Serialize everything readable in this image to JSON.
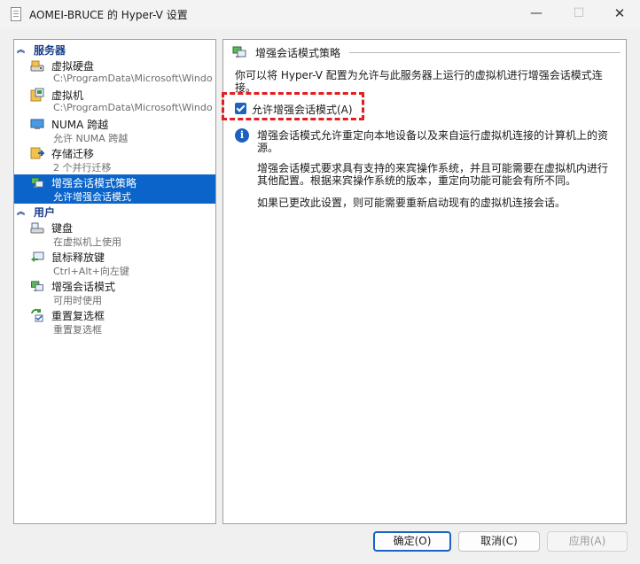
{
  "window": {
    "title": "AOMEI-BRUCE 的 Hyper-V 设置",
    "minimize_glyph": "—",
    "maximize_glyph": "☐",
    "close_glyph": "✕"
  },
  "sidebar": {
    "sections": [
      {
        "label": "服务器",
        "items": [
          {
            "title": "虚拟硬盘",
            "subtitle": "C:\\ProgramData\\Microsoft\\Windo...",
            "icon": "hard-disk-icon"
          },
          {
            "title": "虚拟机",
            "subtitle": "C:\\ProgramData\\Microsoft\\Windo...",
            "icon": "virtual-machine-folder-icon"
          },
          {
            "title": "NUMA 跨越",
            "subtitle": "允许 NUMA 跨越",
            "icon": "numa-monitor-icon"
          },
          {
            "title": "存储迁移",
            "subtitle": "2 个并行迁移",
            "icon": "storage-migration-icon"
          },
          {
            "title": "增强会话模式策略",
            "subtitle": "允许增强会话模式",
            "icon": "enhanced-session-icon",
            "selected": true
          }
        ]
      },
      {
        "label": "用户",
        "items": [
          {
            "title": "键盘",
            "subtitle": "在虚拟机上使用",
            "icon": "keyboard-icon"
          },
          {
            "title": "鼠标释放键",
            "subtitle": "Ctrl+Alt+向左键",
            "icon": "mouse-release-icon"
          },
          {
            "title": "增强会话模式",
            "subtitle": "可用时使用",
            "icon": "enhanced-session-icon"
          },
          {
            "title": "重置复选框",
            "subtitle": "重置复选框",
            "icon": "reset-checkbox-icon"
          }
        ]
      }
    ]
  },
  "main": {
    "title": "增强会话模式策略",
    "description": "你可以将 Hyper-V 配置为允许与此服务器上运行的虚拟机进行增强会话模式连接。",
    "checkbox_label": "允许增强会话模式(A)",
    "checkbox_checked": true,
    "info_paragraphs": [
      "增强会话模式允许重定向本地设备以及来自运行虚拟机连接的计算机上的资源。",
      "增强会话模式要求具有支持的来宾操作系统，并且可能需要在虚拟机内进行其他配置。根据来宾操作系统的版本，重定向功能可能会有所不同。",
      "如果已更改此设置，则可能需要重新启动现有的虚拟机连接会话。"
    ]
  },
  "buttons": {
    "ok": "确定(O)",
    "cancel": "取消(C)",
    "apply": "应用(A)"
  },
  "colors": {
    "selection": "#0a64c9",
    "section_header": "#1a3e8c",
    "highlight_border": "#e21e1e",
    "checkbox_fill": "#1a63c2"
  }
}
